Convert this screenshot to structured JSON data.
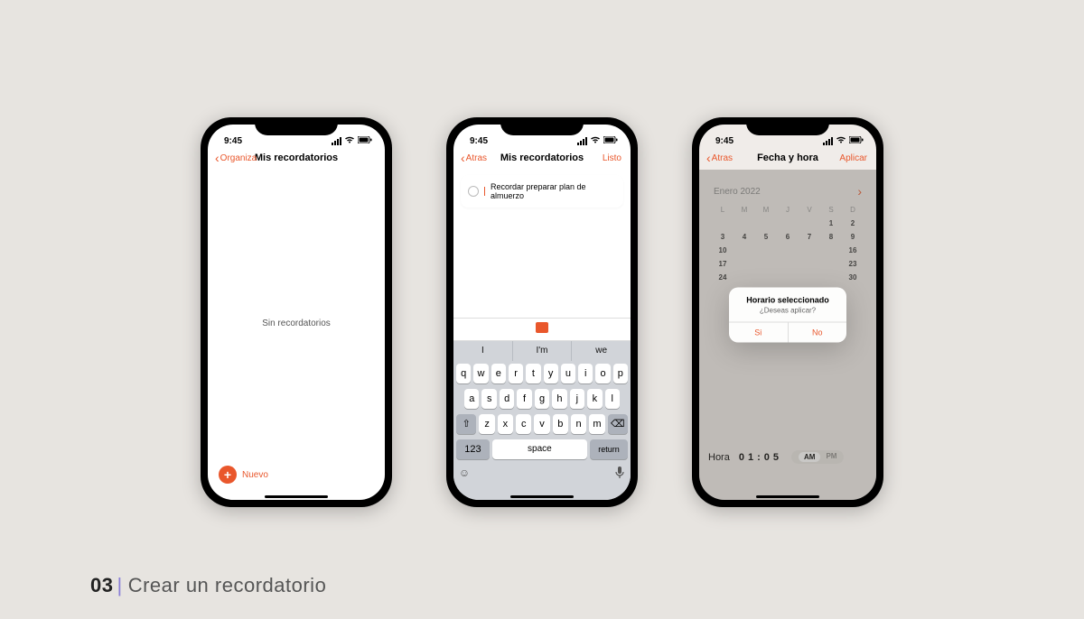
{
  "caption": {
    "num": "03",
    "title": "Crear un recordatorio"
  },
  "status": {
    "time": "9:45"
  },
  "p1": {
    "back": "Organiza",
    "title": "Mis recordatorios",
    "empty": "Sin recordatorios",
    "new": "Nuevo"
  },
  "p2": {
    "back": "Atras",
    "title": "Mis recordatorios",
    "done": "Listo",
    "reminder": "Recordar preparar plan de almuerzo",
    "suggest": [
      "I",
      "I'm",
      "we"
    ],
    "rows": [
      [
        "q",
        "w",
        "e",
        "r",
        "t",
        "y",
        "u",
        "i",
        "o",
        "p"
      ],
      [
        "a",
        "s",
        "d",
        "f",
        "g",
        "h",
        "j",
        "k",
        "l"
      ],
      [
        "z",
        "x",
        "c",
        "v",
        "b",
        "n",
        "m"
      ]
    ],
    "shift": "⇧",
    "del": "⌫",
    "abc": "123",
    "space": "space",
    "ret": "return"
  },
  "p3": {
    "back": "Atras",
    "title": "Fecha y hora",
    "apply": "Aplicar",
    "month": "Enero 2022",
    "dayHeads": [
      "L",
      "M",
      "M",
      "J",
      "V",
      "S",
      "D"
    ],
    "weeks": [
      [
        "",
        "",
        "",
        "",
        "",
        "1",
        "2"
      ],
      [
        "3",
        "4",
        "5",
        "6",
        "7",
        "8",
        "9"
      ],
      [
        "10",
        "",
        "",
        "",
        "",
        "",
        "16"
      ],
      [
        "17",
        "",
        "",
        "",
        "",
        "",
        "23"
      ],
      [
        "24",
        "",
        "",
        "",
        "",
        "",
        "30"
      ]
    ],
    "horaLabel": "Hora",
    "hh": "01",
    "mm": "05",
    "am": "AM",
    "pm": "PM",
    "modalTitle": "Horario seleccionado",
    "modalMsg": "¿Deseas aplicar?",
    "si": "Si",
    "no": "No"
  }
}
